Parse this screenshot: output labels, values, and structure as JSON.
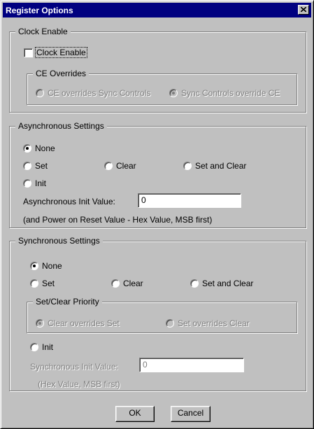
{
  "window": {
    "title": "Register Options"
  },
  "clock_enable": {
    "group_label": "Clock Enable",
    "checkbox_label": "Clock Enable",
    "checked": false,
    "ce_overrides": {
      "group_label": "CE Overrides",
      "options": [
        {
          "label": "CE overrides Sync Controls",
          "selected": false
        },
        {
          "label": "Sync Controls override CE",
          "selected": true
        }
      ]
    }
  },
  "async": {
    "group_label": "Asynchronous Settings",
    "options": [
      {
        "label": "None",
        "selected": true
      },
      {
        "label": "Set",
        "selected": false
      },
      {
        "label": "Clear",
        "selected": false
      },
      {
        "label": "Set and Clear",
        "selected": false
      },
      {
        "label": "Init",
        "selected": false
      }
    ],
    "init_label": "Asynchronous Init Value:",
    "init_value": "0",
    "note": "(and Power on Reset Value - Hex Value, MSB first)"
  },
  "sync": {
    "group_label": "Synchronous Settings",
    "options": [
      {
        "label": "None",
        "selected": true
      },
      {
        "label": "Set",
        "selected": false
      },
      {
        "label": "Clear",
        "selected": false
      },
      {
        "label": "Set and Clear",
        "selected": false
      },
      {
        "label": "Init",
        "selected": false
      }
    ],
    "priority": {
      "group_label": "Set/Clear Priority",
      "options": [
        {
          "label": "Clear overrides Set",
          "selected": true
        },
        {
          "label": "Set overrides Clear",
          "selected": false
        }
      ]
    },
    "init_label": "Synchronous Init Value:",
    "init_value": "0",
    "note": "(Hex Value, MSB first)"
  },
  "buttons": {
    "ok": "OK",
    "cancel": "Cancel"
  }
}
